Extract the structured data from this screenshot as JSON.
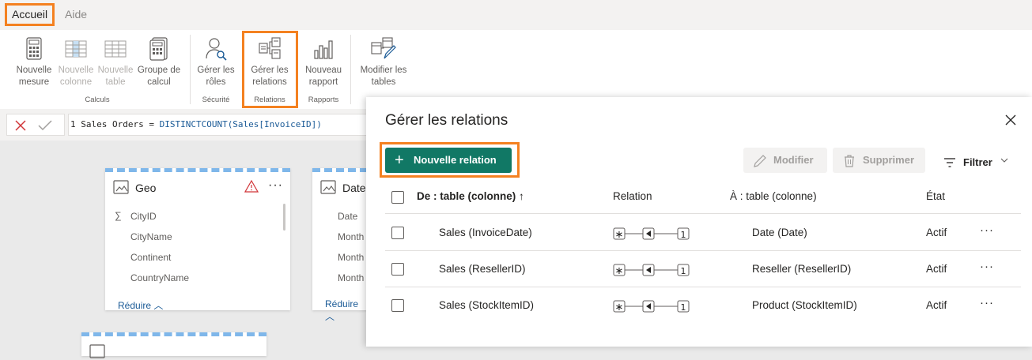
{
  "menu": {
    "tabs": [
      {
        "label": "Accueil",
        "active": true
      },
      {
        "label": "Aide",
        "active": false
      }
    ]
  },
  "ribbon": {
    "buttons": {
      "nouvelle_mesure": "Nouvelle mesure",
      "nouvelle_colonne": "Nouvelle colonne",
      "nouvelle_table": "Nouvelle table",
      "groupe_calcul": "Groupe de calcul",
      "gerer_roles": "Gérer les rôles",
      "gerer_relations": "Gérer les relations",
      "nouveau_rapport": "Nouveau rapport",
      "modifier_tables": "Modifier les tables"
    },
    "groups": {
      "calculs": "Calculs",
      "securite": "Sécurité",
      "relations": "Relations",
      "rapports": "Rapports"
    }
  },
  "formula_bar": {
    "line_number": "1",
    "prefix": "Sales Orders = ",
    "function": "DISTINCTCOUNT",
    "argument": "(Sales[InvoiceID])"
  },
  "canvas": {
    "tables": [
      {
        "name": "Geo",
        "fields": [
          "CityID",
          "CityName",
          "Continent",
          "CountryName"
        ],
        "collapse_label": "Réduire"
      },
      {
        "name": "Date",
        "fields": [
          "Date",
          "Month",
          "Month",
          "Month"
        ],
        "collapse_label": "Réduire"
      }
    ]
  },
  "dialog": {
    "title": "Gérer les relations",
    "new_relation": "Nouvelle relation",
    "modify": "Modifier",
    "delete": "Supprimer",
    "filter": "Filtrer",
    "columns": {
      "from": "De : table (colonne)",
      "relation": "Relation",
      "to": "À : table (colonne)",
      "state": "État"
    },
    "rows": [
      {
        "from": "Sales (InvoiceDate)",
        "many": "∗",
        "one": "1",
        "to": "Date (Date)",
        "state": "Actif"
      },
      {
        "from": "Sales (ResellerID)",
        "many": "∗",
        "one": "1",
        "to": "Reseller (ResellerID)",
        "state": "Actif"
      },
      {
        "from": "Sales (StockItemID)",
        "many": "∗",
        "one": "1",
        "to": "Product (StockItemID)",
        "state": "Actif"
      }
    ]
  },
  "colors": {
    "accent_highlight": "#f48120",
    "primary_button": "#117865",
    "link": "#1a5a96",
    "card_dash": "#7fb7ea",
    "warning": "#d13438"
  }
}
